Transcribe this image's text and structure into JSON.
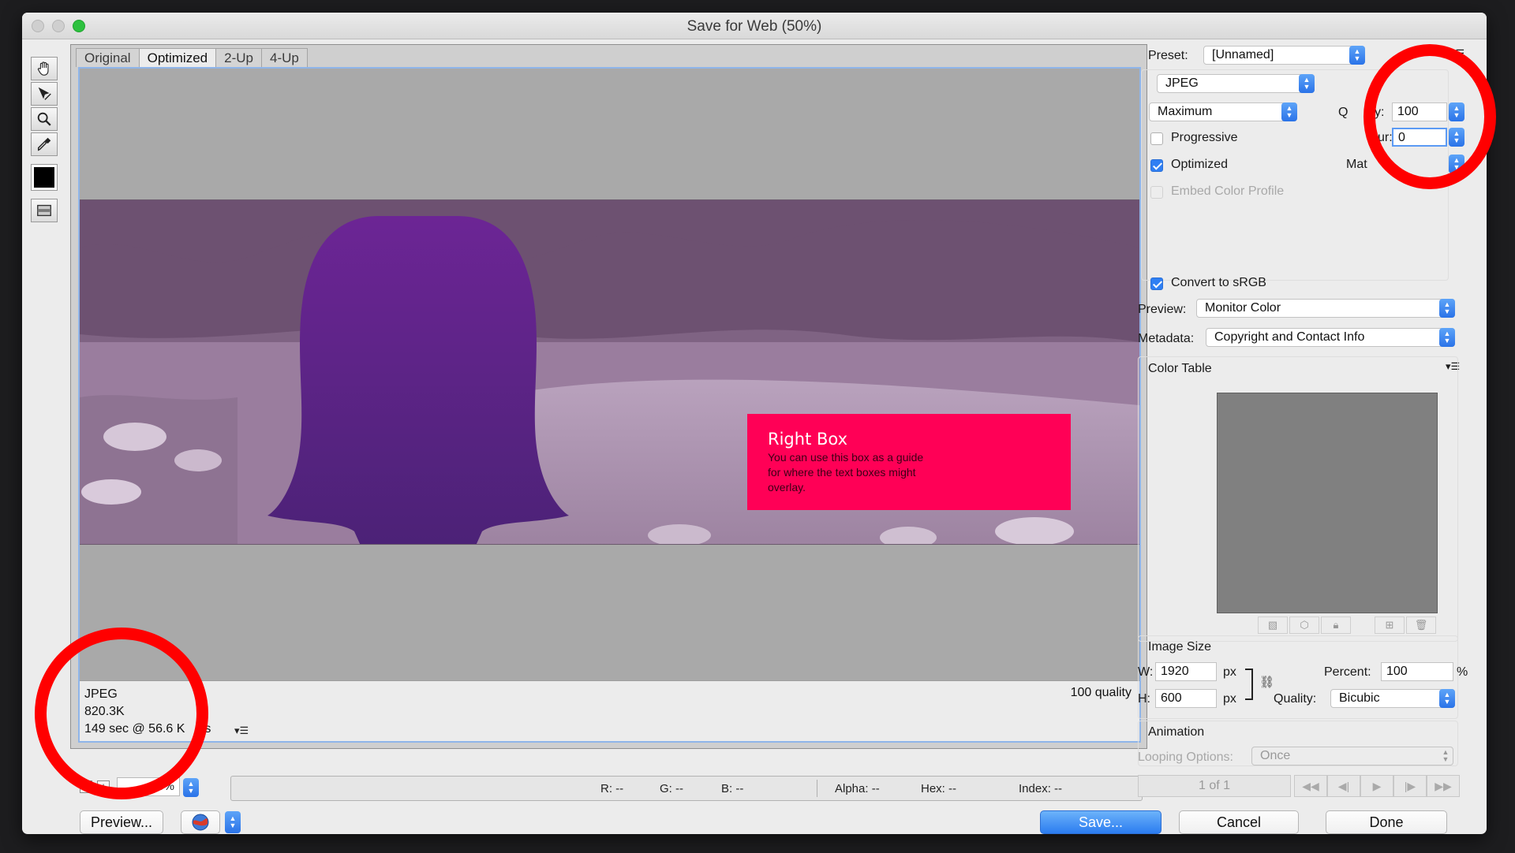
{
  "window": {
    "title": "Save for Web (50%)"
  },
  "tabs": [
    "Original",
    "Optimized",
    "2-Up",
    "4-Up"
  ],
  "preview_image": {
    "box_title": "Right Box",
    "box_body": "You can use this box as a guide for where the text boxes might overlay."
  },
  "info": {
    "format": "JPEG",
    "size": "820.3K",
    "time_partial": "149 sec @ 56.6 K",
    "time_suffix": "ps",
    "quality": "100 quality"
  },
  "status": {
    "zoom": "50%",
    "r": "R: --",
    "g": "G: --",
    "b": "B: --",
    "alpha": "Alpha: --",
    "hex": "Hex: --",
    "index": "Index: --"
  },
  "buttons": {
    "preview": "Preview...",
    "save": "Save...",
    "cancel": "Cancel",
    "done": "Done"
  },
  "settings": {
    "preset_label": "Preset:",
    "preset_value": "[Unnamed]",
    "format": "JPEG",
    "compression": "Maximum",
    "quality_label_partial": "Q",
    "quality_label_suffix": "lity:",
    "quality_value": "100",
    "blur_label_partial": "ur:",
    "blur_value": "0",
    "matte_label_partial": "Mat",
    "progressive": "Progressive",
    "optimized": "Optimized",
    "embed_profile": "Embed Color Profile",
    "convert_srgb": "Convert to sRGB",
    "preview_label": "Preview:",
    "preview_value": "Monitor Color",
    "metadata_label": "Metadata:",
    "metadata_value": "Copyright and Contact Info"
  },
  "color_table": {
    "title": "Color Table"
  },
  "image_size": {
    "title": "Image Size",
    "w_label": "W:",
    "w_value": "1920",
    "h_label": "H:",
    "h_value": "600",
    "unit": "px",
    "percent_label": "Percent:",
    "percent_value": "100",
    "percent_unit": "%",
    "quality_label": "Quality:",
    "quality_value": "Bicubic"
  },
  "animation": {
    "title": "Animation",
    "looping_label": "Looping Options:",
    "looping_value": "Once",
    "frame_counter": "1 of 1"
  },
  "colors": {
    "accent": "#2b7cf0",
    "pink_box": "#ff0056",
    "annotation": "#ff0000",
    "silhouette_top": "#6c2595",
    "silhouette_bottom": "#4b2276"
  }
}
